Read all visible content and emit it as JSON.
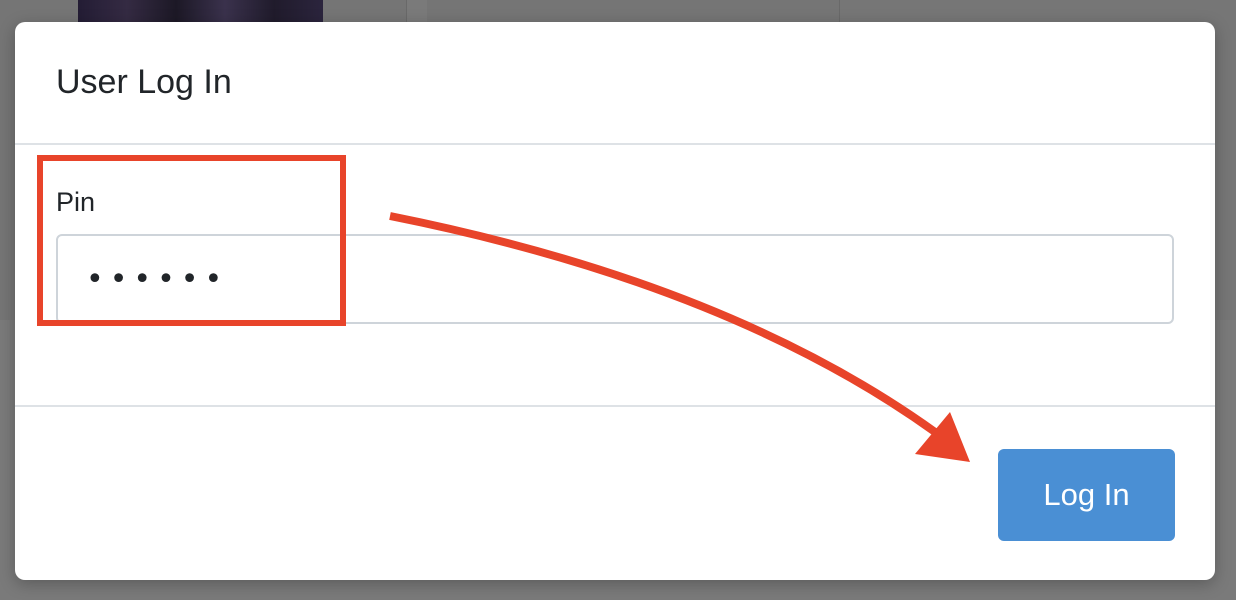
{
  "modal": {
    "title": "User Log In",
    "pin_label": "Pin",
    "pin_value": "123456",
    "login_button_label": "Log In"
  },
  "colors": {
    "primary_button": "#4a8fd4",
    "annotation": "#e8442a",
    "overlay": "rgba(0,0,0,0.52)"
  },
  "annotations": {
    "highlight_target": "pin-field",
    "arrow_target": "login-button"
  }
}
